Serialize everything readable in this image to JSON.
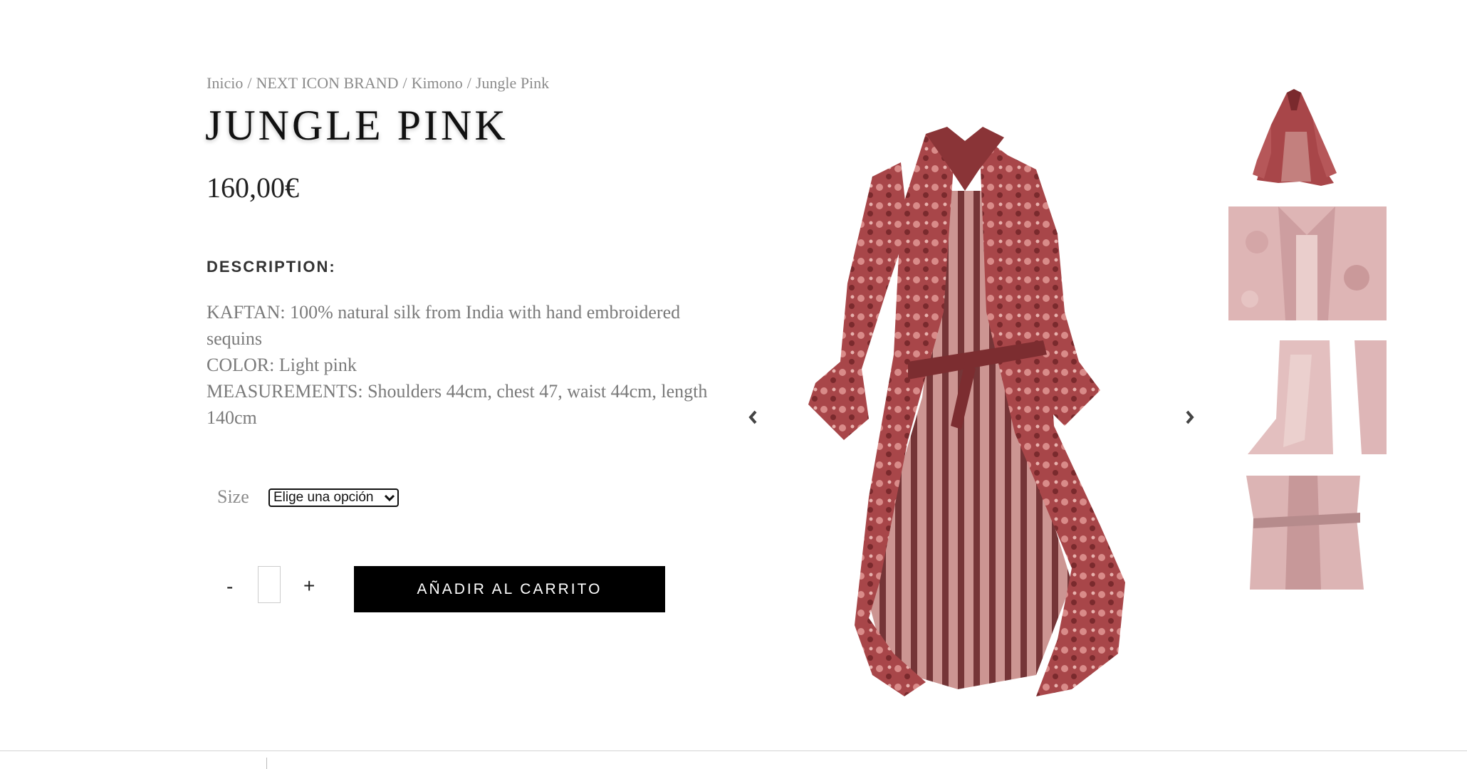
{
  "breadcrumb": {
    "items": [
      "Inicio",
      "NEXT ICON BRAND",
      "Kimono",
      "Jungle Pink"
    ],
    "separator": "/"
  },
  "product": {
    "title": "JUNGLE PINK",
    "price": "160,00€",
    "description_heading": "DESCRIPTION:",
    "description_lines": [
      "KAFTAN: 100% natural silk from India with hand embroidered sequins",
      "COLOR: Light pink",
      "MEASUREMENTS: Shoulders 44cm, chest 47, waist 44cm, length 140cm"
    ]
  },
  "size": {
    "label": "Size",
    "selected": "Elige una opción"
  },
  "quantity": {
    "minus": "-",
    "plus": "+",
    "value": ""
  },
  "cart": {
    "add_label": "AÑADIR AL CARRITO"
  },
  "gallery": {
    "prev_icon": "chevron-left-icon",
    "next_icon": "chevron-right-icon",
    "prev_glyph": "‹",
    "next_glyph": "›"
  },
  "colors": {
    "button_bg": "#000000",
    "button_text": "#ffffff",
    "dress_red": "#9b3b3e",
    "dress_pink": "#d88a8a"
  }
}
